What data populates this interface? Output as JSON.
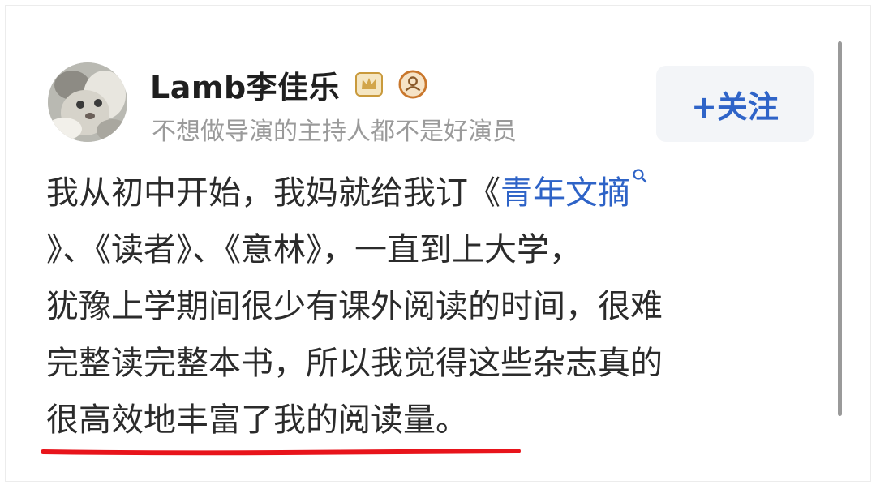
{
  "author": {
    "name": "Lamb李佳乐",
    "bio": "不想做导演的主持人都不是好演员",
    "avatar_icon": "cat-avatar-icon",
    "badges": [
      "crown-badge-icon",
      "person-badge-icon"
    ]
  },
  "follow_button": {
    "label": "+关注"
  },
  "post": {
    "line1_prefix": "我从初中开始，我妈就给我订《",
    "line1_link": "青年文摘",
    "line2": "》、《读者》、《意林》，一直到上大学，",
    "line3": "犹豫上学期间很少有课外阅读的时间，很难",
    "line4": "完整读完整本书，所以我觉得这些杂志真的",
    "line5_underlined": "很高效地丰富了我的阅读量",
    "line5_end": "。"
  },
  "colors": {
    "link": "#2e63c7",
    "follow": "#2f64c8",
    "underline": "#e8141b",
    "bio": "#9a9a9a"
  }
}
